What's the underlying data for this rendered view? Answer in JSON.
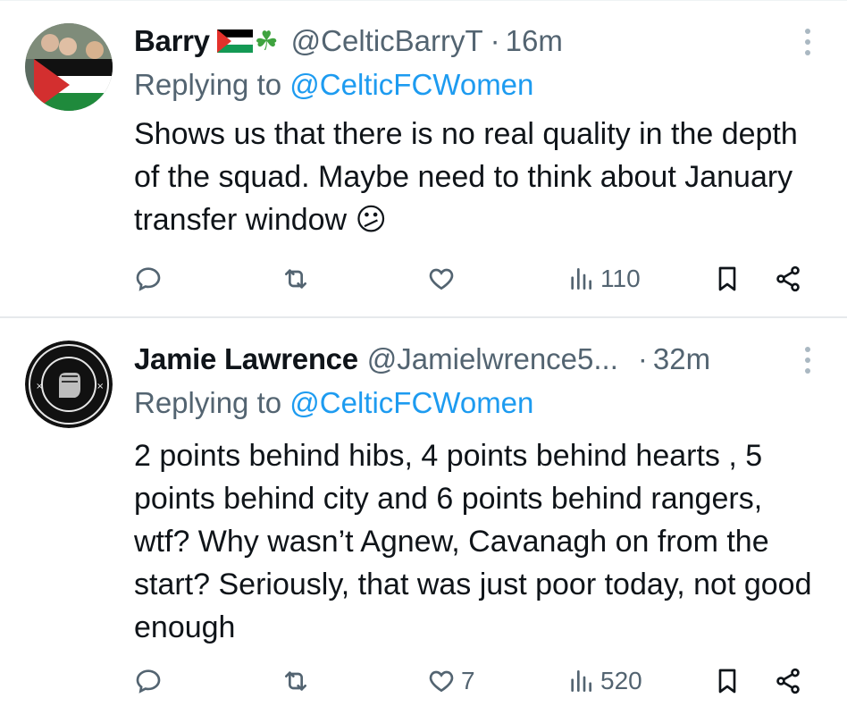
{
  "tweets": [
    {
      "author": "Barry",
      "handle": "@CelticBarryT",
      "separator": "·",
      "time": "16m",
      "reply_prefix": "Replying to",
      "reply_to": "@CelticFCWomen",
      "text": "Shows us that there is no real quality in the depth of the squad. Maybe need to think about January transfer window 😕",
      "replies": "",
      "retweets": "",
      "likes": "",
      "views": "110"
    },
    {
      "author": "Jamie Lawrence",
      "handle": "@Jamielwrence5...",
      "separator": "·",
      "time": "32m",
      "reply_prefix": "Replying to",
      "reply_to": "@CelticFCWomen",
      "text": "2 points behind hibs, 4 points behind hearts , 5 points behind city and 6 points behind rangers, wtf? Why wasn’t Agnew, Cavanagh on from the start? Seriously, that was just poor today, not good enough",
      "replies": "",
      "retweets": "",
      "likes": "7",
      "views": "520"
    }
  ],
  "icons": {
    "reply": "reply-icon",
    "retweet": "retweet-icon",
    "like": "heart-icon",
    "views": "views-icon",
    "bookmark": "bookmark-icon",
    "share": "share-icon",
    "more": "more-icon"
  },
  "colors": {
    "link": "#1d9bf0",
    "secondary_text": "#536471",
    "primary_text": "#0f1419"
  }
}
